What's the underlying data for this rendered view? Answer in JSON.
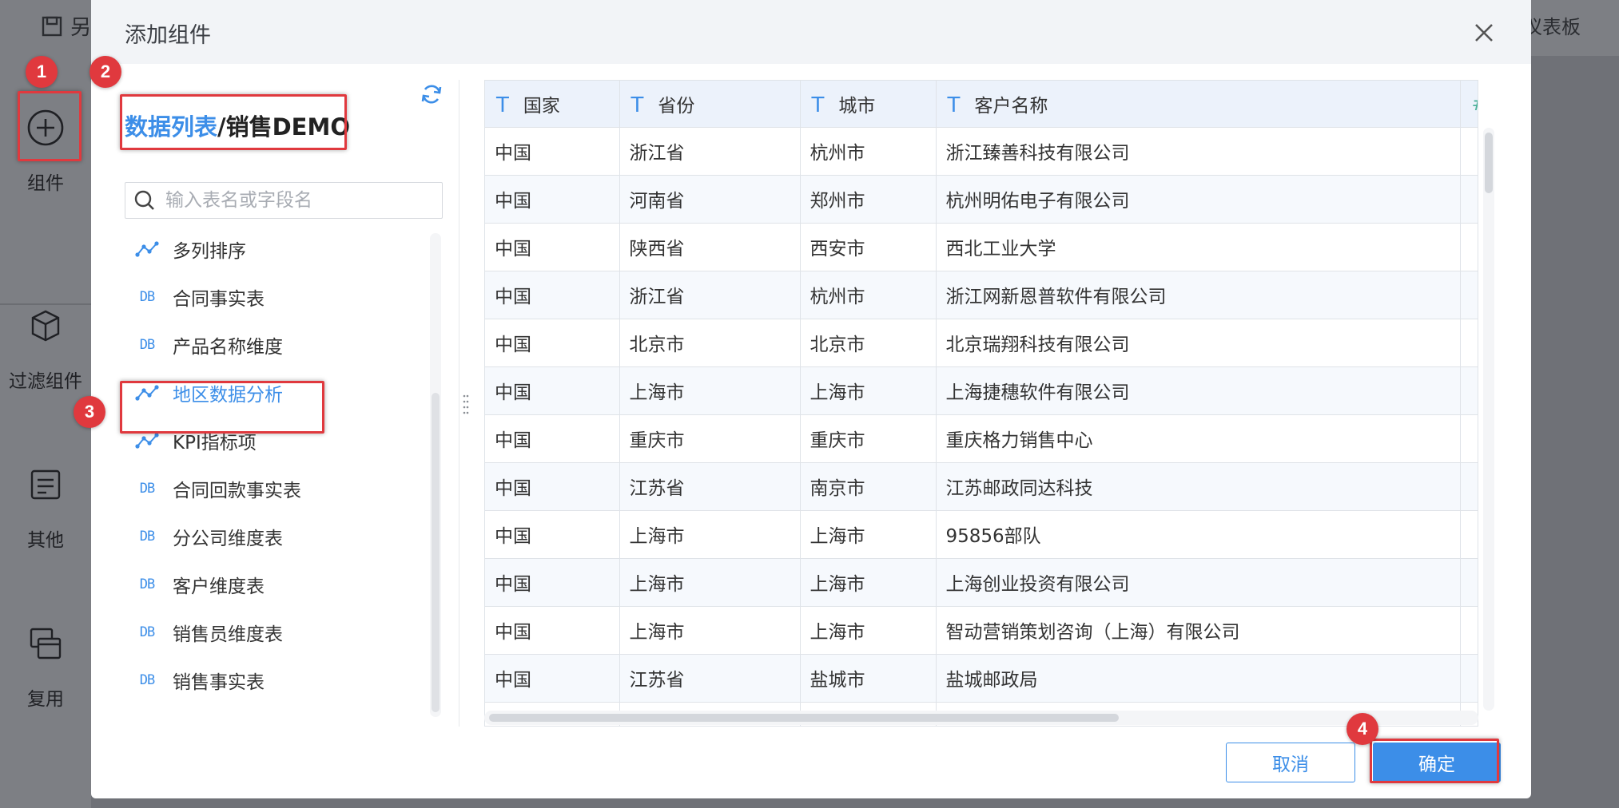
{
  "background": {
    "topbar": {
      "save_as_label": "另",
      "dashboard_label": "仪表板"
    },
    "sidebar": {
      "items": [
        {
          "label": "组件",
          "icon": "plus-circle-icon"
        },
        {
          "label": "过滤组件",
          "icon": "cube-icon"
        },
        {
          "label": "其他",
          "icon": "note-icon"
        },
        {
          "label": "复用",
          "icon": "copy-icon"
        }
      ]
    }
  },
  "dialog": {
    "title": "添加组件",
    "breadcrumb": {
      "root": "数据列表",
      "separator": "/",
      "leaf": "销售DEMO"
    },
    "search_placeholder": "输入表名或字段名",
    "list": [
      {
        "label": "多列排序",
        "type": "analysis",
        "icon": "analysis-icon"
      },
      {
        "label": "合同事实表",
        "type": "db",
        "icon": "DB"
      },
      {
        "label": "产品名称维度",
        "type": "db",
        "icon": "DB"
      },
      {
        "label": "地区数据分析",
        "type": "analysis",
        "icon": "analysis-icon",
        "selected": true
      },
      {
        "label": "KPI指标项",
        "type": "analysis",
        "icon": "analysis-icon"
      },
      {
        "label": "合同回款事实表",
        "type": "db",
        "icon": "DB"
      },
      {
        "label": "分公司维度表",
        "type": "db",
        "icon": "DB"
      },
      {
        "label": "客户维度表",
        "type": "db",
        "icon": "DB"
      },
      {
        "label": "销售员维度表",
        "type": "db",
        "icon": "DB"
      },
      {
        "label": "销售事实表",
        "type": "db",
        "icon": "DB"
      }
    ],
    "table": {
      "columns": [
        {
          "type_icon": "T",
          "label": "国家"
        },
        {
          "type_icon": "T",
          "label": "省份"
        },
        {
          "type_icon": "T",
          "label": "城市"
        },
        {
          "type_icon": "T",
          "label": "客户名称"
        },
        {
          "type_icon": "#",
          "label": ""
        }
      ],
      "rows": [
        [
          "中国",
          "浙江省",
          "杭州市",
          "浙江臻善科技有限公司",
          ""
        ],
        [
          "中国",
          "河南省",
          "郑州市",
          "杭州明佑电子有限公司",
          ""
        ],
        [
          "中国",
          "陕西省",
          "西安市",
          "西北工业大学",
          ""
        ],
        [
          "中国",
          "浙江省",
          "杭州市",
          "浙江网新恩普软件有限公司",
          ""
        ],
        [
          "中国",
          "北京市",
          "北京市",
          "北京瑞翔科技有限公司",
          ""
        ],
        [
          "中国",
          "上海市",
          "上海市",
          "上海捷穗软件有限公司",
          ""
        ],
        [
          "中国",
          "重庆市",
          "重庆市",
          "重庆格力销售中心",
          ""
        ],
        [
          "中国",
          "江苏省",
          "南京市",
          "江苏邮政同达科技",
          ""
        ],
        [
          "中国",
          "上海市",
          "上海市",
          "95856部队",
          ""
        ],
        [
          "中国",
          "上海市",
          "上海市",
          "上海创业投资有限公司",
          ""
        ],
        [
          "中国",
          "上海市",
          "上海市",
          "智动营销策划咨询（上海）有限公司",
          ""
        ],
        [
          "中国",
          "江苏省",
          "盐城市",
          "盐城邮政局",
          ""
        ],
        [
          "",
          "",
          "",
          "",
          ""
        ]
      ]
    },
    "cancel_label": "取消",
    "ok_label": "确定"
  },
  "annotations": [
    "1",
    "2",
    "3",
    "4"
  ],
  "colors": {
    "accent": "#3c8ee8",
    "highlight": "#e0393e",
    "number_type": "#4db29a"
  }
}
